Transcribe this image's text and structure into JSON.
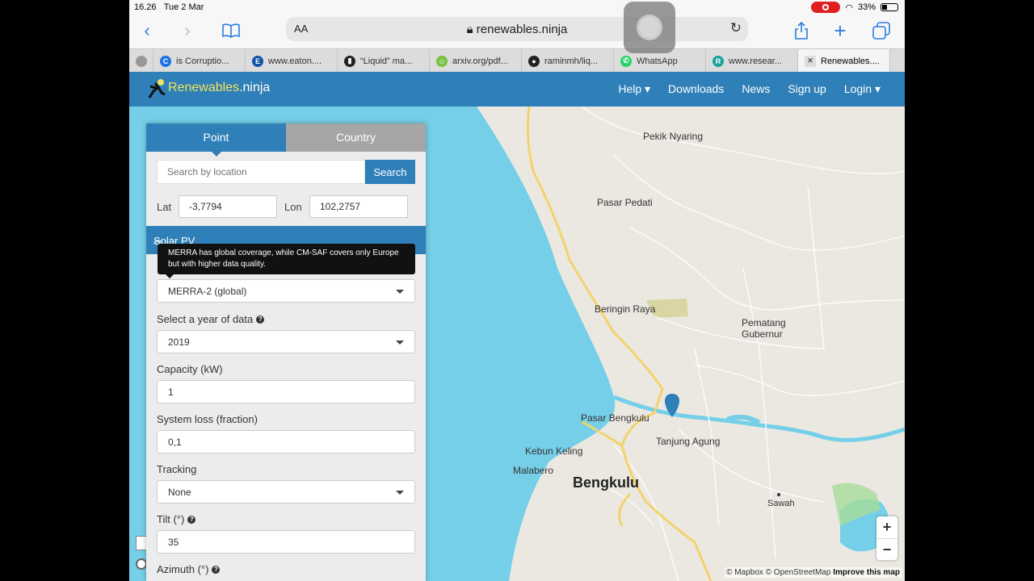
{
  "status_bar": {
    "time": "16.26",
    "date": "Tue 2 Mar",
    "battery": "33%"
  },
  "browser": {
    "text_size_label": "AA",
    "url": "renewables.ninja",
    "tabs": [
      {
        "title": "",
        "fav_color": "#999999",
        "fav_glyph": ""
      },
      {
        "title": "is Corruptio...",
        "fav_color": "#1a73e8",
        "fav_glyph": "C"
      },
      {
        "title": "www.eaton....",
        "fav_color": "#1155aa",
        "fav_glyph": "E"
      },
      {
        "title": "“Liquid” ma...",
        "fav_color": "#222222",
        "fav_glyph": "▮"
      },
      {
        "title": "arxiv.org/pdf...",
        "fav_color": "#7ac142",
        "fav_glyph": "☺"
      },
      {
        "title": "raminmh/liq...",
        "fav_color": "#222222",
        "fav_glyph": "●"
      },
      {
        "title": "WhatsApp",
        "fav_color": "#25d366",
        "fav_glyph": "✆"
      },
      {
        "title": "www.resear...",
        "fav_color": "#1aa39b",
        "fav_glyph": "R"
      },
      {
        "title": "Renewables....",
        "fav_color": "#dddddd",
        "fav_glyph": "✕"
      }
    ]
  },
  "site": {
    "brand_main": "Renewables",
    "brand_suffix": ".ninja",
    "nav": {
      "help": "Help",
      "downloads": "Downloads",
      "news": "News",
      "signup": "Sign up",
      "login": "Login"
    }
  },
  "panel": {
    "tab_point": "Point",
    "tab_country": "Country",
    "search_placeholder": "Search by location",
    "search_button": "Search",
    "lat_label": "Lat",
    "lat_value": "-3,7794",
    "lon_label": "Lon",
    "lon_value": "102,2757",
    "section_title": "Solar PV",
    "tooltip": "MERRA has global coverage, while CM-SAF covers only Europe but with higher data quality.",
    "dataset_value": "MERRA-2 (global)",
    "year_label": "Select a year of data",
    "year_value": "2019",
    "capacity_label": "Capacity (kW)",
    "capacity_value": "1",
    "loss_label": "System loss (fraction)",
    "loss_value": "0,1",
    "tracking_label": "Tracking",
    "tracking_value": "None",
    "tilt_label": "Tilt (°)",
    "tilt_value": "35",
    "azimuth_label": "Azimuth (°)"
  },
  "map": {
    "labels": {
      "pekik": "Pekik Nyaring",
      "pedati": "Pasar Pedati",
      "beringin": "Beringin Raya",
      "pematang1": "Pematang",
      "pematang2": "Gubernur",
      "pasar_bengkulu": "Pasar Bengkulu",
      "tanjung": "Tanjung Agung",
      "kebun": "Kebun Keling",
      "malabero": "Malabero",
      "bengkulu": "Bengkulu",
      "sawah": "Sawah"
    },
    "zoom_in": "+",
    "zoom_out": "−",
    "attribution_1": "© Mapbox © OpenStreetMap",
    "attribution_2": "Improve this map",
    "colors": {
      "sea": "#75cfe8",
      "land": "#ebe8e2",
      "road": "#f3d36b",
      "marker": "#2f7fb8"
    }
  }
}
